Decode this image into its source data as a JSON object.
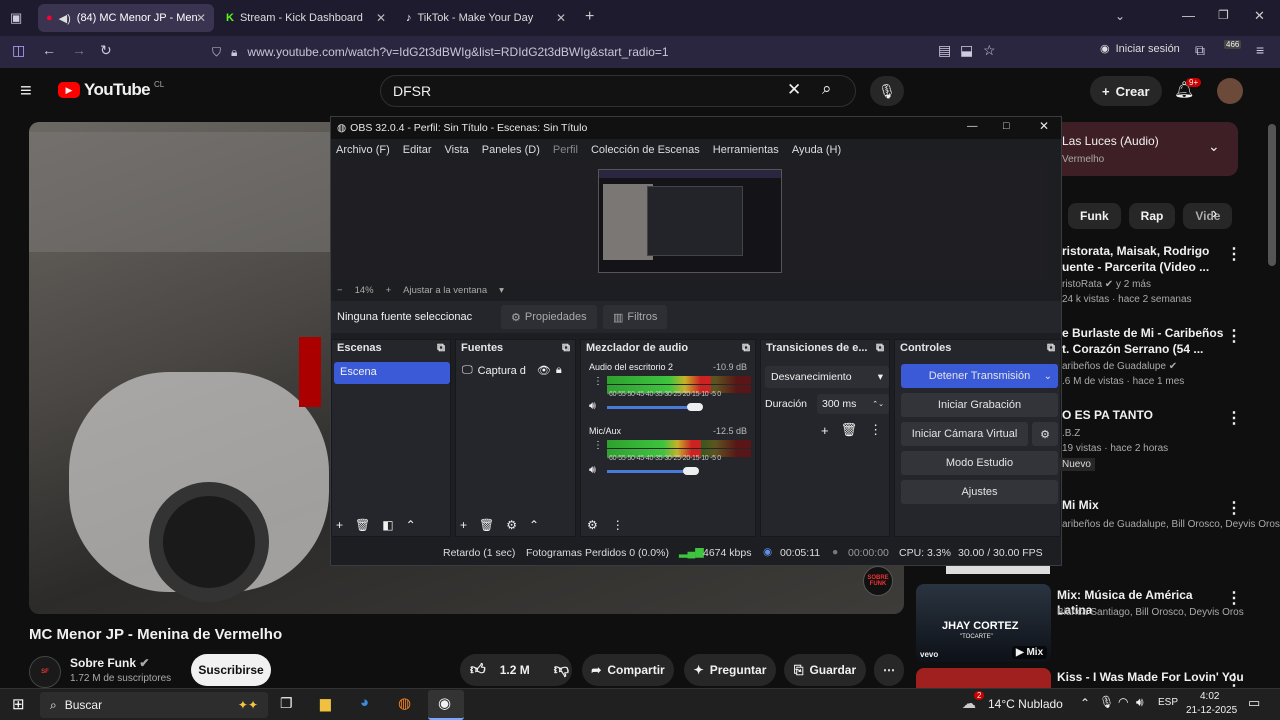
{
  "browser": {
    "tabs": [
      {
        "label": "(84) MC Menor JP - Menina",
        "icon": "youtube-icon"
      },
      {
        "label": "Stream - Kick Dashboard",
        "icon": "kick-icon"
      },
      {
        "label": "TikTok - Make Your Day",
        "icon": "tiktok-icon"
      }
    ],
    "url": "www.youtube.com/watch?v=IdG2t3dBWIg&list=RDIdG2t3dBWIg&start_radio=1",
    "signin_label": "Iniciar sesión",
    "ext_badge": "466"
  },
  "youtube": {
    "logo_text": "YouTube",
    "country": "CL",
    "search_value": "DFSR",
    "create_label": "Crear",
    "notif_badge": "9+"
  },
  "obs": {
    "title": "OBS 32.0.4 - Perfil: Sin Título - Escenas: Sin Título",
    "menu": [
      "Archivo (F)",
      "Editar",
      "Vista",
      "Paneles (D)",
      "Perfil",
      "Colección de Escenas",
      "Herramientas",
      "Ayuda (H)"
    ],
    "zoom": "14%",
    "fit_label": "Ajustar a la ventana",
    "no_source": "Ninguna fuente seleccionac",
    "properties_label": "Propiedades",
    "filters_label": "Filtros",
    "docks": {
      "scenes": "Escenas",
      "sources": "Fuentes",
      "mixer": "Mezclador de audio",
      "transitions": "Transiciones de e...",
      "controls": "Controles"
    },
    "scene_item": "Escena",
    "source_item": "Captura d",
    "audio": [
      {
        "name": "Audio del escritorio 2",
        "db": "-10.9 dB",
        "level": 0.72
      },
      {
        "name": "Mic/Aux",
        "db": "-12.5 dB",
        "level": 0.65
      }
    ],
    "scale_text": "-60-55-50-45-40-35-30-25-20-15-10 -5  0",
    "transition": "Desvanecimiento",
    "duration_label": "Duración",
    "duration_value": "300 ms",
    "controls": [
      "Detener Transmisión",
      "Iniciar Grabación",
      "Iniciar Cámara Virtual",
      "Modo Estudio",
      "Ajustes"
    ],
    "status": {
      "delay": "Retardo (1 sec)",
      "dropped": "Fotogramas Perdidos 0 (0.0%)",
      "bitrate": "4674 kbps",
      "stream_time": "00:05:11",
      "rec_time": "00:00:00",
      "cpu": "CPU: 3.3%",
      "fps": "30.00 / 30.00 FPS"
    }
  },
  "sidebar": {
    "playlist_title": "Las Luces (Audio)",
    "playlist_sub": "Vermelho",
    "chips": [
      "Funk",
      "Rap",
      "Vide"
    ],
    "items": [
      {
        "title1": "ristorata, Maisak, Rodrigo",
        "title2": "uente - Parcerita (Video ...",
        "sub1": "ristoRata ✔ y 2 más",
        "sub2": "24 k vistas · hace 2 semanas"
      },
      {
        "title1": "e Burlaste de Mi - Caribeños",
        "title2": "t. Corazón Serrano (54 ...",
        "sub1": "aribeños de Guadalupe ✔",
        "sub2": ".6 M de vistas · hace 1 mes"
      },
      {
        "title1": "O ES PA TANTO",
        "title2": "",
        "sub1": ".B.Z",
        "sub2": "19 vistas · hace 2 horas",
        "badge": "Nuevo"
      },
      {
        "title1": "Mi Mix",
        "title2": "",
        "sub1": "aribeños de Guadalupe, Bill Orosco, Deyvis Oros",
        "sub2": ""
      },
      {
        "title1": "Mix: Música de América Latina",
        "title2": "",
        "sub1": "Bianca Santiago, Bill Orosco, Deyvis Oros",
        "sub2": ""
      },
      {
        "title1": "Kiss - I Was Made For Lovin' You",
        "title2": "",
        "sub1": "",
        "sub2": ""
      }
    ],
    "thumb_text": "JHAY CORTEZ",
    "thumb_sub": "\"TOCARTE\"",
    "thumb_vevo": "vevo",
    "thumb_mix": "Mix"
  },
  "video": {
    "title": "MC Menor JP - Menina de Vermelho",
    "channel": "Sobre Funk",
    "subs": "1.72 M de suscriptores",
    "subscribe": "Suscribirse",
    "likes": "1.2 M",
    "share": "Compartir",
    "ask": "Preguntar",
    "save": "Guardar",
    "watermark": "SOBRE FUNK"
  },
  "taskbar": {
    "search": "Buscar",
    "weather": "14°C  Nublado",
    "weather_badge": "2",
    "lang": "ESP",
    "time": "4:02",
    "date": "21-12-2025"
  }
}
